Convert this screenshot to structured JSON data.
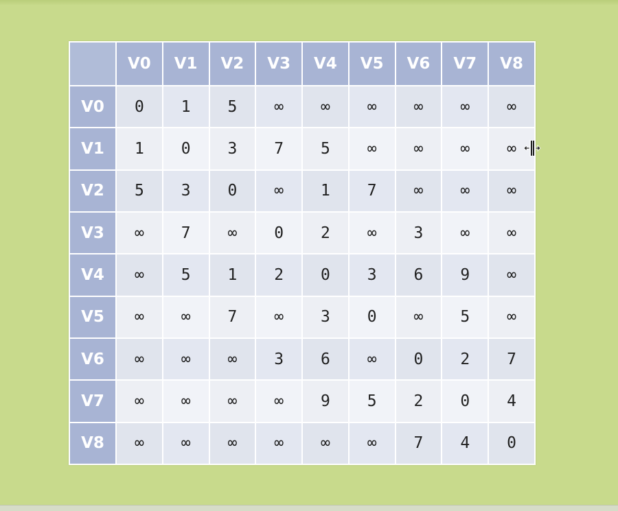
{
  "matrix": {
    "corner": "",
    "columns": [
      "V0",
      "V1",
      "V2",
      "V3",
      "V4",
      "V5",
      "V6",
      "V7",
      "V8"
    ],
    "rows": [
      {
        "label": "V0",
        "cells": [
          "0",
          "1",
          "5",
          "∞",
          "∞",
          "∞",
          "∞",
          "∞",
          "∞"
        ]
      },
      {
        "label": "V1",
        "cells": [
          "1",
          "0",
          "3",
          "7",
          "5",
          "∞",
          "∞",
          "∞",
          "∞"
        ]
      },
      {
        "label": "V2",
        "cells": [
          "5",
          "3",
          "0",
          "∞",
          "1",
          "7",
          "∞",
          "∞",
          "∞"
        ]
      },
      {
        "label": "V3",
        "cells": [
          "∞",
          "7",
          "∞",
          "0",
          "2",
          "∞",
          "3",
          "∞",
          "∞"
        ]
      },
      {
        "label": "V4",
        "cells": [
          "∞",
          "5",
          "1",
          "2",
          "0",
          "3",
          "6",
          "9",
          "∞"
        ]
      },
      {
        "label": "V5",
        "cells": [
          "∞",
          "∞",
          "7",
          "∞",
          "3",
          "0",
          "∞",
          "5",
          "∞"
        ]
      },
      {
        "label": "V6",
        "cells": [
          "∞",
          "∞",
          "∞",
          "3",
          "6",
          "∞",
          "0",
          "2",
          "7"
        ]
      },
      {
        "label": "V7",
        "cells": [
          "∞",
          "∞",
          "∞",
          "∞",
          "9",
          "5",
          "2",
          "0",
          "4"
        ]
      },
      {
        "label": "V8",
        "cells": [
          "∞",
          "∞",
          "∞",
          "∞",
          "∞",
          "∞",
          "7",
          "4",
          "0"
        ]
      }
    ]
  },
  "colors": {
    "background": "#c8da8c",
    "header": "#a8b4d4",
    "cell_odd": "#e3e7f1",
    "cell_even": "#f1f3f8"
  },
  "cursor": {
    "icon": "column-resize-cursor-icon"
  }
}
